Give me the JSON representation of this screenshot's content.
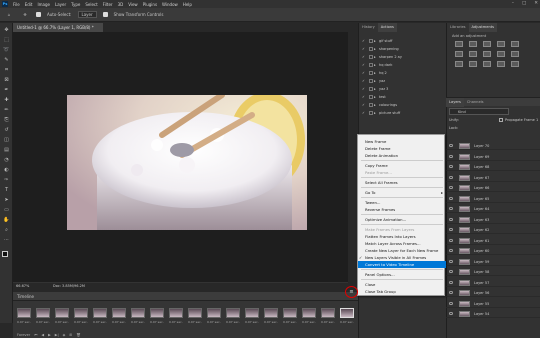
{
  "menubar": {
    "logo": "Ps",
    "items": [
      "File",
      "Edit",
      "Image",
      "Layer",
      "Type",
      "Select",
      "Filter",
      "3D",
      "View",
      "Plugins",
      "Window",
      "Help"
    ],
    "window_controls": [
      "–",
      "□",
      "✕"
    ]
  },
  "options": {
    "auto_select_label": "Auto-Select:",
    "auto_select_value": "Layer",
    "show_transform_label": "Show Transform Controls"
  },
  "document": {
    "tab_title": "Untitled-1 @ 66.7% (Layer 1, RGB/8) *",
    "zoom": "66.67%",
    "doc_info": "Doc: 3.85M/96.2M"
  },
  "timeline": {
    "title": "Timeline",
    "frames": [
      {
        "num": "62",
        "delay": "0.07 sec."
      },
      {
        "num": "63",
        "delay": "0.07 sec."
      },
      {
        "num": "64",
        "delay": "0.07 sec."
      },
      {
        "num": "65",
        "delay": "0.07 sec."
      },
      {
        "num": "66",
        "delay": "0.07 sec."
      },
      {
        "num": "67",
        "delay": "0.07 sec."
      },
      {
        "num": "68",
        "delay": "0.07 sec."
      },
      {
        "num": "69",
        "delay": "0.07 sec."
      },
      {
        "num": "70",
        "delay": "0.07 sec."
      },
      {
        "num": "71",
        "delay": "0.07 sec."
      },
      {
        "num": "72",
        "delay": "0.07 sec."
      },
      {
        "num": "73",
        "delay": "0.07 sec."
      },
      {
        "num": "74",
        "delay": "0.07 sec."
      },
      {
        "num": "75",
        "delay": "0.07 sec."
      },
      {
        "num": "76",
        "delay": "0.07 sec."
      },
      {
        "num": "77",
        "delay": "0.07 sec."
      },
      {
        "num": "78",
        "delay": "0.07 sec."
      },
      {
        "num": "79",
        "delay": "0.07 sec."
      }
    ],
    "loop_value": "Forever"
  },
  "history_actions": {
    "tabs": [
      "History",
      "Actions"
    ],
    "rows": [
      {
        "label": "gif stuff",
        "check": "✓"
      },
      {
        "label": "sharpening",
        "check": "✓"
      },
      {
        "label": "sharpen 2 ay",
        "check": "✓"
      },
      {
        "label": "hq dark",
        "check": "✓"
      },
      {
        "label": "hq 2",
        "check": "✓"
      },
      {
        "label": "yaz",
        "check": "✓"
      },
      {
        "label": "yaz 3",
        "check": "✓"
      },
      {
        "label": "test",
        "check": "✓"
      },
      {
        "label": "colourings",
        "check": "✓"
      },
      {
        "label": "picture stuff",
        "check": "✓"
      }
    ]
  },
  "right_panels": {
    "tabs": [
      "Libraries",
      "Adjustments"
    ],
    "adjust_label": "Add an adjustment",
    "layers_tabs": [
      "Layers",
      "Channels"
    ],
    "kind_label": "Kind",
    "unify_label": "Unify:",
    "propagate_label": "Propagate Frame 1",
    "lock_label": "Lock:",
    "layers": [
      "Layer 70",
      "Layer 69",
      "Layer 68",
      "Layer 67",
      "Layer 66",
      "Layer 65",
      "Layer 64",
      "Layer 63",
      "Layer 62",
      "Layer 61",
      "Layer 60",
      "Layer 59",
      "Layer 58",
      "Layer 57",
      "Layer 56",
      "Layer 55",
      "Layer 54"
    ]
  },
  "context_menu": {
    "items": [
      {
        "label": "New Frame",
        "state": "normal"
      },
      {
        "label": "Delete Frame",
        "state": "normal"
      },
      {
        "label": "Delete Animation",
        "state": "normal"
      },
      {
        "sep": true
      },
      {
        "label": "Copy Frame",
        "state": "normal"
      },
      {
        "label": "Paste Frame...",
        "state": "disabled"
      },
      {
        "sep": true
      },
      {
        "label": "Select All Frames",
        "state": "normal"
      },
      {
        "sep": true
      },
      {
        "label": "Go To",
        "state": "normal",
        "submenu": "▸"
      },
      {
        "sep": true
      },
      {
        "label": "Tween...",
        "state": "normal"
      },
      {
        "label": "Reverse Frames",
        "state": "normal"
      },
      {
        "sep": true
      },
      {
        "label": "Optimize Animation...",
        "state": "normal"
      },
      {
        "sep": true
      },
      {
        "label": "Make Frames From Layers",
        "state": "disabled"
      },
      {
        "label": "Flatten Frames Into Layers",
        "state": "normal"
      },
      {
        "label": "Match Layer Across Frames...",
        "state": "normal"
      },
      {
        "label": "Create New Layer for Each New Frame",
        "state": "normal"
      },
      {
        "label": "New Layers Visible in All Frames",
        "state": "normal",
        "check": "✓"
      },
      {
        "label": "Convert to Video Timeline",
        "state": "highlighted"
      },
      {
        "sep": true
      },
      {
        "label": "Panel Options...",
        "state": "normal"
      },
      {
        "sep": true
      },
      {
        "label": "Close",
        "state": "normal"
      },
      {
        "label": "Close Tab Group",
        "state": "normal"
      }
    ]
  },
  "colors": {
    "highlight": "#0078d7",
    "annotation_circle": "#e00000",
    "panel_bg": "#323232"
  }
}
